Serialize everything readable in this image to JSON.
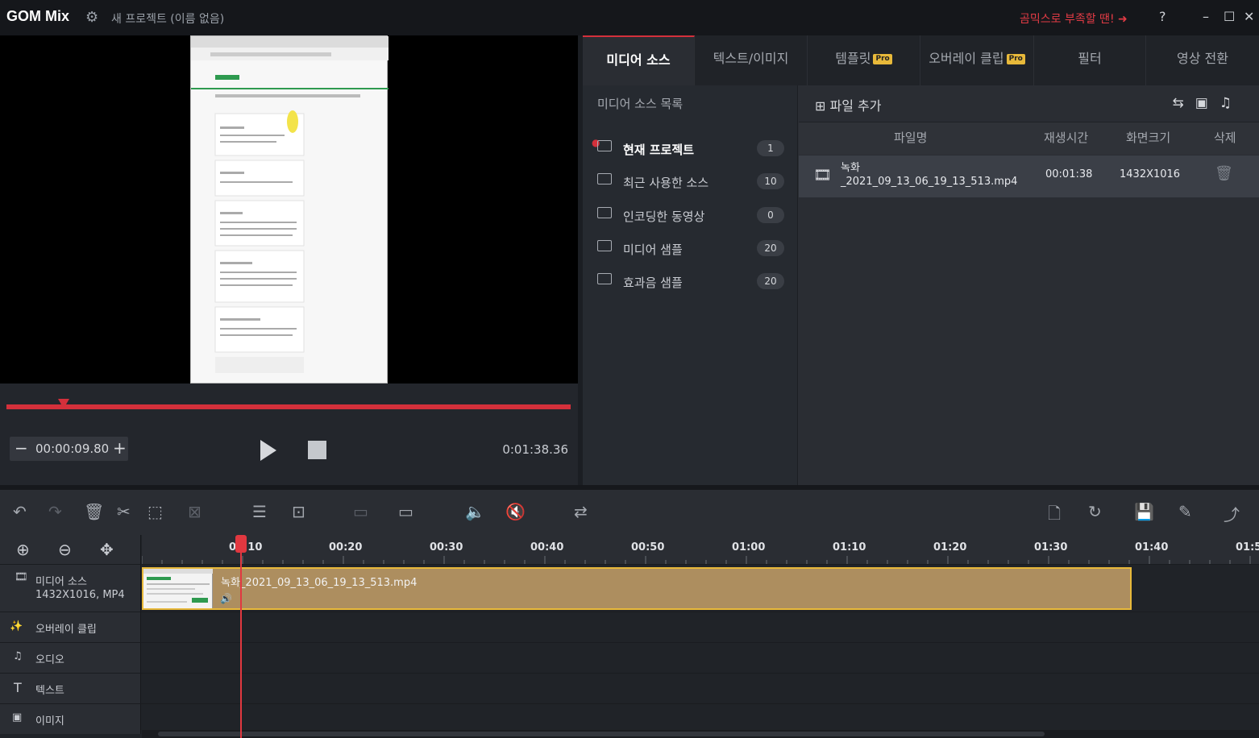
{
  "titlebar": {
    "logo": "GOM Mix",
    "project_title": "새 프로젝트 (이름 없음)",
    "promo": "곰믹스로 부족할 땐! ➜",
    "help": "?",
    "minimize": "–",
    "maximize": "☐",
    "close": "✕"
  },
  "player": {
    "current_time": "00:00:09.80",
    "duration": "0:01:38.36",
    "progress_fraction": 0.1
  },
  "tabs": [
    {
      "label": "미디어 소스",
      "pro": false
    },
    {
      "label": "텍스트/이미지",
      "pro": false
    },
    {
      "label": "템플릿",
      "pro": true
    },
    {
      "label": "오버레이 클립",
      "pro": true
    },
    {
      "label": "필터",
      "pro": false
    },
    {
      "label": "영상 전환",
      "pro": false
    }
  ],
  "pro_badge": "Pro",
  "source_list": {
    "header": "미디어 소스 목록",
    "items": [
      {
        "label": "현재 프로젝트",
        "count": "1"
      },
      {
        "label": "최근 사용한 소스",
        "count": "10"
      },
      {
        "label": "인코딩한 동영상",
        "count": "0"
      },
      {
        "label": "미디어 샘플",
        "count": "20"
      },
      {
        "label": "효과음 샘플",
        "count": "20"
      }
    ]
  },
  "file_panel": {
    "add_file": "파일 추가",
    "columns": [
      "파일명",
      "재생시간",
      "화면크기",
      "삭제"
    ],
    "rows": [
      {
        "name_line1": "녹화",
        "name_line2": "_2021_09_13_06_19_13_513.mp4",
        "duration": "00:01:38",
        "size": "1432X1016"
      }
    ]
  },
  "timeline": {
    "ticks": [
      "00:10",
      "00:20",
      "00:30",
      "00:40",
      "00:50",
      "01:00",
      "01:10",
      "01:20",
      "01:30",
      "01:40",
      "01:5"
    ],
    "tracks": [
      {
        "name": "미디어 소스",
        "sub": "1432X1016, MP4"
      },
      {
        "name": "오버레이 클립"
      },
      {
        "name": "오디오"
      },
      {
        "name": "텍스트"
      },
      {
        "name": "이미지"
      }
    ],
    "clip_name": "녹화_2021_09_13_06_19_13_513.mp4"
  },
  "colors": {
    "accent": "#d4303b",
    "clip": "#ad8e5f",
    "clip_border": "#e8b93a"
  }
}
